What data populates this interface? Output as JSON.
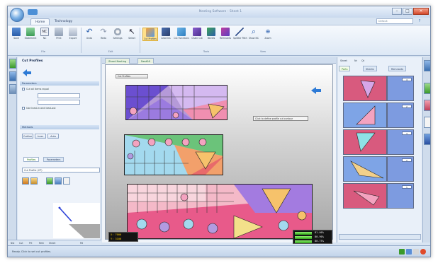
{
  "window": {
    "title": "Nesting Software - Sheet 1",
    "tabs": [
      "Home",
      "Technology"
    ],
    "search_placeholder": "Default",
    "help": "?"
  },
  "ribbon": {
    "buttons": [
      {
        "label": "Save",
        "icon": "save-icon"
      },
      {
        "label": "Statement",
        "icon": "statement-icon"
      },
      {
        "label": "NC",
        "icon": "nc-icon"
      },
      {
        "label": "Print",
        "icon": "print-icon"
      },
      {
        "label": "Export",
        "icon": "export-icon"
      },
      {
        "label": "Undo",
        "icon": "undo-icon"
      },
      {
        "label": "Redo",
        "icon": "redo-icon"
      },
      {
        "label": "Settings",
        "icon": "settings-icon"
      },
      {
        "label": "Select",
        "icon": "select-icon"
      },
      {
        "label": "Cut Profiles",
        "icon": "cut-profiles-icon"
      },
      {
        "label": "Lead Ins",
        "icon": "lead-ins-icon"
      },
      {
        "label": "Cut Functions",
        "icon": "cut-functions-icon"
      },
      {
        "label": "Chain Cut",
        "icon": "chain-cut-icon"
      },
      {
        "label": "Bevels",
        "icon": "bevels-icon"
      },
      {
        "label": "Remnants",
        "icon": "remnants-icon"
      },
      {
        "label": "Splitter Path",
        "icon": "splitter-path-icon"
      },
      {
        "label": "Show NC",
        "icon": "show-nc-icon"
      },
      {
        "label": "Zoom",
        "icon": "zoom-icon"
      }
    ],
    "groups": [
      "File",
      "Edit",
      "Tools",
      "View"
    ]
  },
  "left_panel": {
    "title": "Cut Profiles",
    "section1": "Parameters",
    "checkbox1": "Cut all items equal",
    "checkbox2": "Use lead-in and lead-out",
    "section2": "Methods",
    "method_buttons": [
      "Outline",
      "Inner",
      "Auto"
    ],
    "tabs": [
      "Profiles",
      "Parameters"
    ],
    "select_value": "Cut Profile (CP)",
    "bottom_tabs": [
      "Nst",
      "Cut",
      "Prt",
      "Rem",
      "Sheet",
      "Mt"
    ]
  },
  "center": {
    "doc_tabs": [
      "Sheet Nesting",
      "Nest06"
    ],
    "chip": "Cut Profiles",
    "tooltip": "Click to define profile cut contour",
    "info": {
      "x_label": "X:",
      "x_value": "7000",
      "y_label": "Y:",
      "y_value": "3100"
    },
    "yields": [
      "81.00%",
      "80.90%",
      "80.75%"
    ]
  },
  "right_panel": {
    "toolbar": [
      "Sheet",
      "Nr",
      "Qt"
    ],
    "tabs": [
      "Parts",
      "Sheets",
      "Remnants"
    ],
    "parts": [
      {
        "qty": "4",
        "color": "#d85a7e"
      },
      {
        "qty": "2",
        "color": "#7ea4e6"
      },
      {
        "qty": "3",
        "color": "#d85a7e"
      },
      {
        "qty": "2",
        "color": "#7ea4e6"
      },
      {
        "qty": "5",
        "color": "#d85a7e"
      }
    ]
  },
  "status": {
    "text": "Ready. Click to set cut profiles."
  },
  "colors": {
    "accent_blue": "#2d7ad6",
    "part_pink": "#d85a7e",
    "part_blue": "#7ea4e6",
    "yield_green": "#3dcc2a",
    "info_yellow": "#ffd200"
  }
}
